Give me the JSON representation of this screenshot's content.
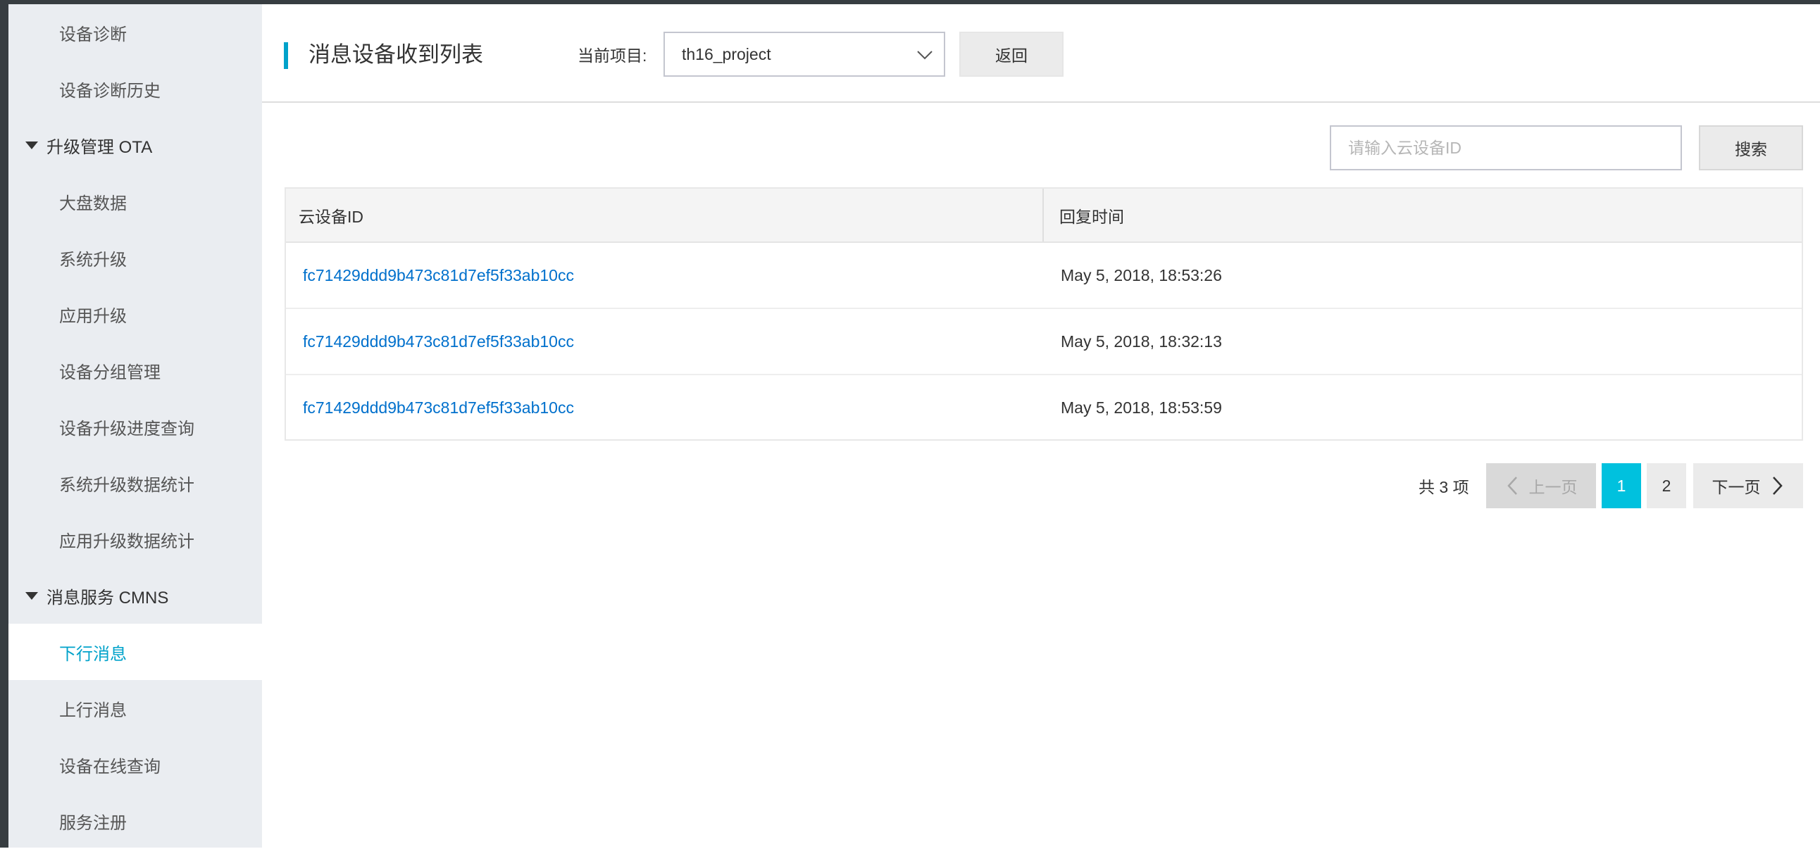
{
  "colors": {
    "accent": "#00a2ca",
    "link": "#0070cc",
    "active_page": "#00c1de",
    "sidebar_bg": "#eaedf1"
  },
  "sidebar": {
    "items": [
      {
        "label": "设备诊断",
        "type": "item"
      },
      {
        "label": "设备诊断历史",
        "type": "item"
      },
      {
        "label": "升级管理 OTA",
        "type": "group",
        "icon": "caret-down-icon"
      },
      {
        "label": "大盘数据",
        "type": "item"
      },
      {
        "label": "系统升级",
        "type": "item"
      },
      {
        "label": "应用升级",
        "type": "item"
      },
      {
        "label": "设备分组管理",
        "type": "item"
      },
      {
        "label": "设备升级进度查询",
        "type": "item"
      },
      {
        "label": "系统升级数据统计",
        "type": "item"
      },
      {
        "label": "应用升级数据统计",
        "type": "item"
      },
      {
        "label": "消息服务 CMNS",
        "type": "group",
        "icon": "caret-down-icon"
      },
      {
        "label": "下行消息",
        "type": "item",
        "active": true
      },
      {
        "label": "上行消息",
        "type": "item"
      },
      {
        "label": "设备在线查询",
        "type": "item"
      },
      {
        "label": "服务注册",
        "type": "item"
      }
    ]
  },
  "header": {
    "title": "消息设备收到列表",
    "project_label": "当前项目:",
    "project_value": "th16_project",
    "back_label": "返回"
  },
  "search": {
    "placeholder": "请输入云设备ID",
    "button_label": "搜索"
  },
  "table": {
    "columns": [
      "云设备ID",
      "回复时间"
    ],
    "rows": [
      {
        "device_id": "fc71429ddd9b473c81d7ef5f33ab10cc",
        "reply_time": "May 5, 2018, 18:53:26"
      },
      {
        "device_id": "fc71429ddd9b473c81d7ef5f33ab10cc",
        "reply_time": "May 5, 2018, 18:32:13"
      },
      {
        "device_id": "fc71429ddd9b473c81d7ef5f33ab10cc",
        "reply_time": "May 5, 2018, 18:53:59"
      }
    ]
  },
  "pagination": {
    "total_text": "共 3 项",
    "prev_label": "上一页",
    "next_label": "下一页",
    "pages": [
      "1",
      "2"
    ],
    "current_page": "1"
  }
}
